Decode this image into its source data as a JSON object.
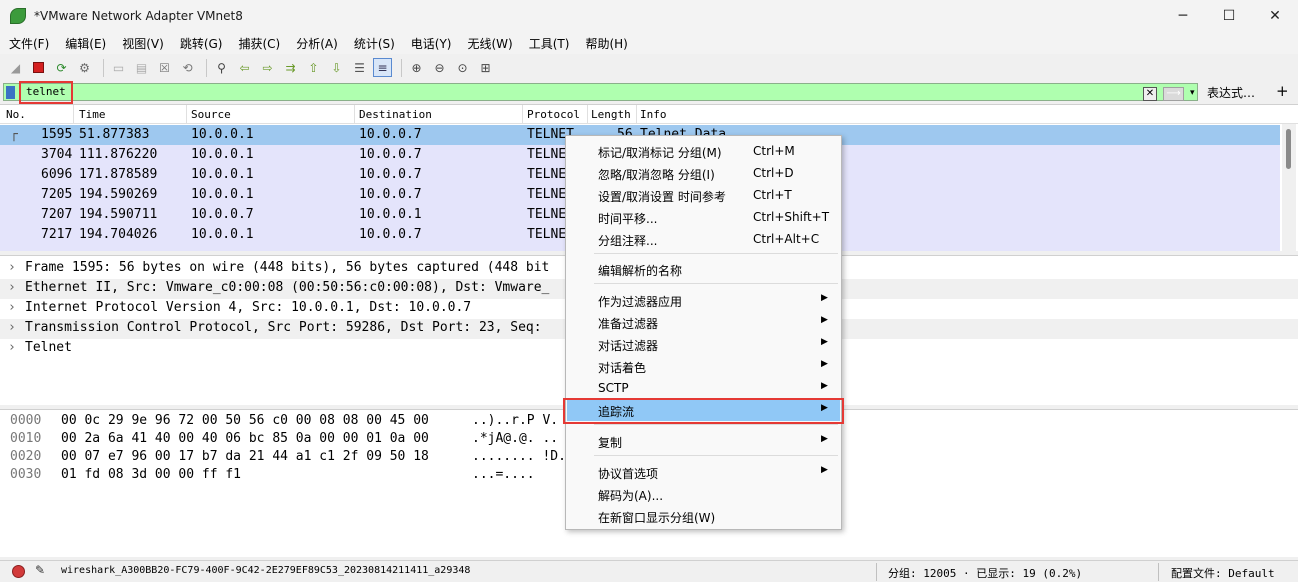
{
  "window": {
    "title": "*VMware Network Adapter VMnet8",
    "minimize": "─",
    "maximize": "☐",
    "close": "✕"
  },
  "menubar": [
    "文件(F)",
    "编辑(E)",
    "视图(V)",
    "跳转(G)",
    "捕获(C)",
    "分析(A)",
    "统计(S)",
    "电话(Y)",
    "无线(W)",
    "工具(T)",
    "帮助(H)"
  ],
  "filter": {
    "value": "telnet",
    "expression_label": "表达式…",
    "plus": "+",
    "clear": "✕",
    "apply": "⟶",
    "dropdown": "▾"
  },
  "packet_list": {
    "columns": [
      "No.",
      "Time",
      "Source",
      "Destination",
      "Protocol",
      "Length",
      "Info"
    ],
    "rows": [
      {
        "no": "1595",
        "time": "51.877383",
        "src": "10.0.0.1",
        "dst": "10.0.0.7",
        "proto": "TELNET",
        "len": "56",
        "info": "Telnet Data",
        "selected": true
      },
      {
        "no": "3704",
        "time": "111.876220",
        "src": "10.0.0.1",
        "dst": "10.0.0.7",
        "proto": "TELNE",
        "len": "",
        "info": ""
      },
      {
        "no": "6096",
        "time": "171.878589",
        "src": "10.0.0.1",
        "dst": "10.0.0.7",
        "proto": "TELNE",
        "len": "",
        "info": ""
      },
      {
        "no": "7205",
        "time": "194.590269",
        "src": "10.0.0.1",
        "dst": "10.0.0.7",
        "proto": "TELNE",
        "len": "",
        "info": ""
      },
      {
        "no": "7207",
        "time": "194.590711",
        "src": "10.0.0.7",
        "dst": "10.0.0.1",
        "proto": "TELNE",
        "len": "",
        "info": ""
      },
      {
        "no": "7217",
        "time": "194.704026",
        "src": "10.0.0.1",
        "dst": "10.0.0.7",
        "proto": "TELNE",
        "len": "",
        "info": ""
      }
    ]
  },
  "details": [
    "Frame 1595: 56 bytes on wire (448 bits), 56 bytes captured (448 bit",
    "Ethernet II, Src: Vmware_c0:00:08 (00:50:56:c0:00:08), Dst: Vmware_",
    "Internet Protocol Version 4, Src: 10.0.0.1, Dst: 10.0.0.7",
    "Transmission Control Protocol, Src Port: 59286, Dst Port: 23, Seq:",
    "Telnet"
  ],
  "hex": [
    {
      "offset": "0000",
      "bytes": "00 0c 29 9e 96 72 00 50  56 c0 00 08 08 00 45 00",
      "ascii": "..)..r.P V."
    },
    {
      "offset": "0010",
      "bytes": "00 2a 6a 41 40 00 40 06  bc 85 0a 00 00 01 0a 00",
      "ascii": ".*jA@.@. .."
    },
    {
      "offset": "0020",
      "bytes": "00 07 e7 96 00 17 b7 da  21 44 a1 c1 2f 09 50 18",
      "ascii": "........ !D."
    },
    {
      "offset": "0030",
      "bytes": "01 fd 08 3d 00 00 ff f1",
      "ascii": "...=...."
    }
  ],
  "context_menu": [
    {
      "label": "标记/取消标记 分组(M)",
      "shortcut": "Ctrl+M"
    },
    {
      "label": "忽略/取消忽略 分组(I)",
      "shortcut": "Ctrl+D"
    },
    {
      "label": "设置/取消设置 时间参考",
      "shortcut": "Ctrl+T"
    },
    {
      "label": "时间平移...",
      "shortcut": "Ctrl+Shift+T"
    },
    {
      "label": "分组注释...",
      "shortcut": "Ctrl+Alt+C"
    },
    {
      "label": "编辑解析的名称",
      "shortcut": ""
    },
    {
      "label": "作为过滤器应用",
      "shortcut": "",
      "submenu": true
    },
    {
      "label": "准备过滤器",
      "shortcut": "",
      "submenu": true
    },
    {
      "label": "对话过滤器",
      "shortcut": "",
      "submenu": true
    },
    {
      "label": "对话着色",
      "shortcut": "",
      "submenu": true
    },
    {
      "label": "SCTP",
      "shortcut": "",
      "submenu": true
    },
    {
      "label": "追踪流",
      "shortcut": "",
      "submenu": true,
      "hover": true
    },
    {
      "label": "复制",
      "shortcut": "",
      "submenu": true
    },
    {
      "label": "协议首选项",
      "shortcut": "",
      "submenu": true
    },
    {
      "label": "解码为(A)...",
      "shortcut": ""
    },
    {
      "label": "在新窗口显示分组(W)",
      "shortcut": ""
    }
  ],
  "statusbar": {
    "file": "wireshark_A300BB20-FC79-400F-9C42-2E279EF89C53_20230814211411_a29348",
    "packets": "分组: 12005 · 已显示: 19 (0.2%)",
    "profile": "配置文件: Default"
  },
  "colors": {
    "filter_bg": "#afffaf",
    "row_bg": "#e4e4fb",
    "row_selected": "#9ec8ef",
    "menu_hover": "#90c8f6",
    "highlight_box": "#e53935"
  }
}
